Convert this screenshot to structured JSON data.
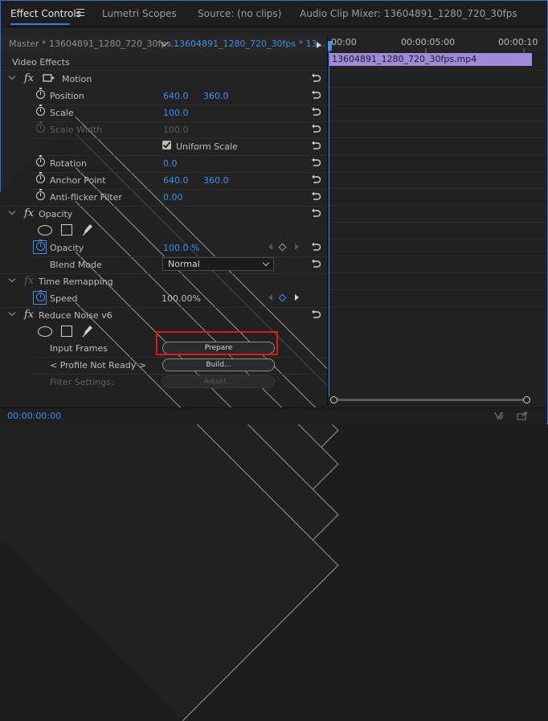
{
  "tabs": {
    "effect_controls": "Effect Controls",
    "lumetri_scopes": "Lumetri Scopes",
    "source": "Source: (no clips)",
    "audio_clip_mixer": "Audio Clip Mixer: 13604891_1280_720_30fps"
  },
  "header": {
    "master": "Master * 13604891_1280_720_30fps...",
    "clip": "13604891_1280_720_30fps * 13..."
  },
  "section_title": "Video Effects",
  "motion": {
    "name": "Motion",
    "position": {
      "label": "Position",
      "x": "640.0",
      "y": "360.0"
    },
    "scale": {
      "label": "Scale",
      "value": "100.0"
    },
    "scale_width": {
      "label": "Scale Width",
      "value": "100.0"
    },
    "uniform_scale": {
      "label": "Uniform Scale",
      "checked": true
    },
    "rotation": {
      "label": "Rotation",
      "value": "0.0"
    },
    "anchor_point": {
      "label": "Anchor Point",
      "x": "640.0",
      "y": "360.0"
    },
    "anti_flicker": {
      "label": "Anti-flicker Filter",
      "value": "0.00"
    }
  },
  "opacity": {
    "name": "Opacity",
    "opacity": {
      "label": "Opacity",
      "value": "100.0 %"
    },
    "blend_mode": {
      "label": "Blend Mode",
      "value": "Normal"
    }
  },
  "time_remapping": {
    "name": "Time Remapping",
    "speed": {
      "label": "Speed",
      "value": "100.00%"
    }
  },
  "reduce_noise": {
    "name": "Reduce Noise v6",
    "input_frames": {
      "label": "Input Frames",
      "button": "Prepare"
    },
    "profile": {
      "label": "< Profile Not Ready >",
      "button": "Build..."
    },
    "filter_settings": {
      "label": "Filter Settings:",
      "button": "Adjust..."
    }
  },
  "timeline": {
    "tc_start": "00:00",
    "tc_mid": "00:00:05:00",
    "tc_end": "00:00:10",
    "clip_name": "13604891_1280_720_30fps.mp4"
  },
  "footer": {
    "timecode": "00:00:00:00"
  },
  "colors": {
    "accent": "#2d7cf6",
    "value_blue": "#3d8ee8",
    "clip": "#9f89d9",
    "highlight": "#e11818"
  }
}
